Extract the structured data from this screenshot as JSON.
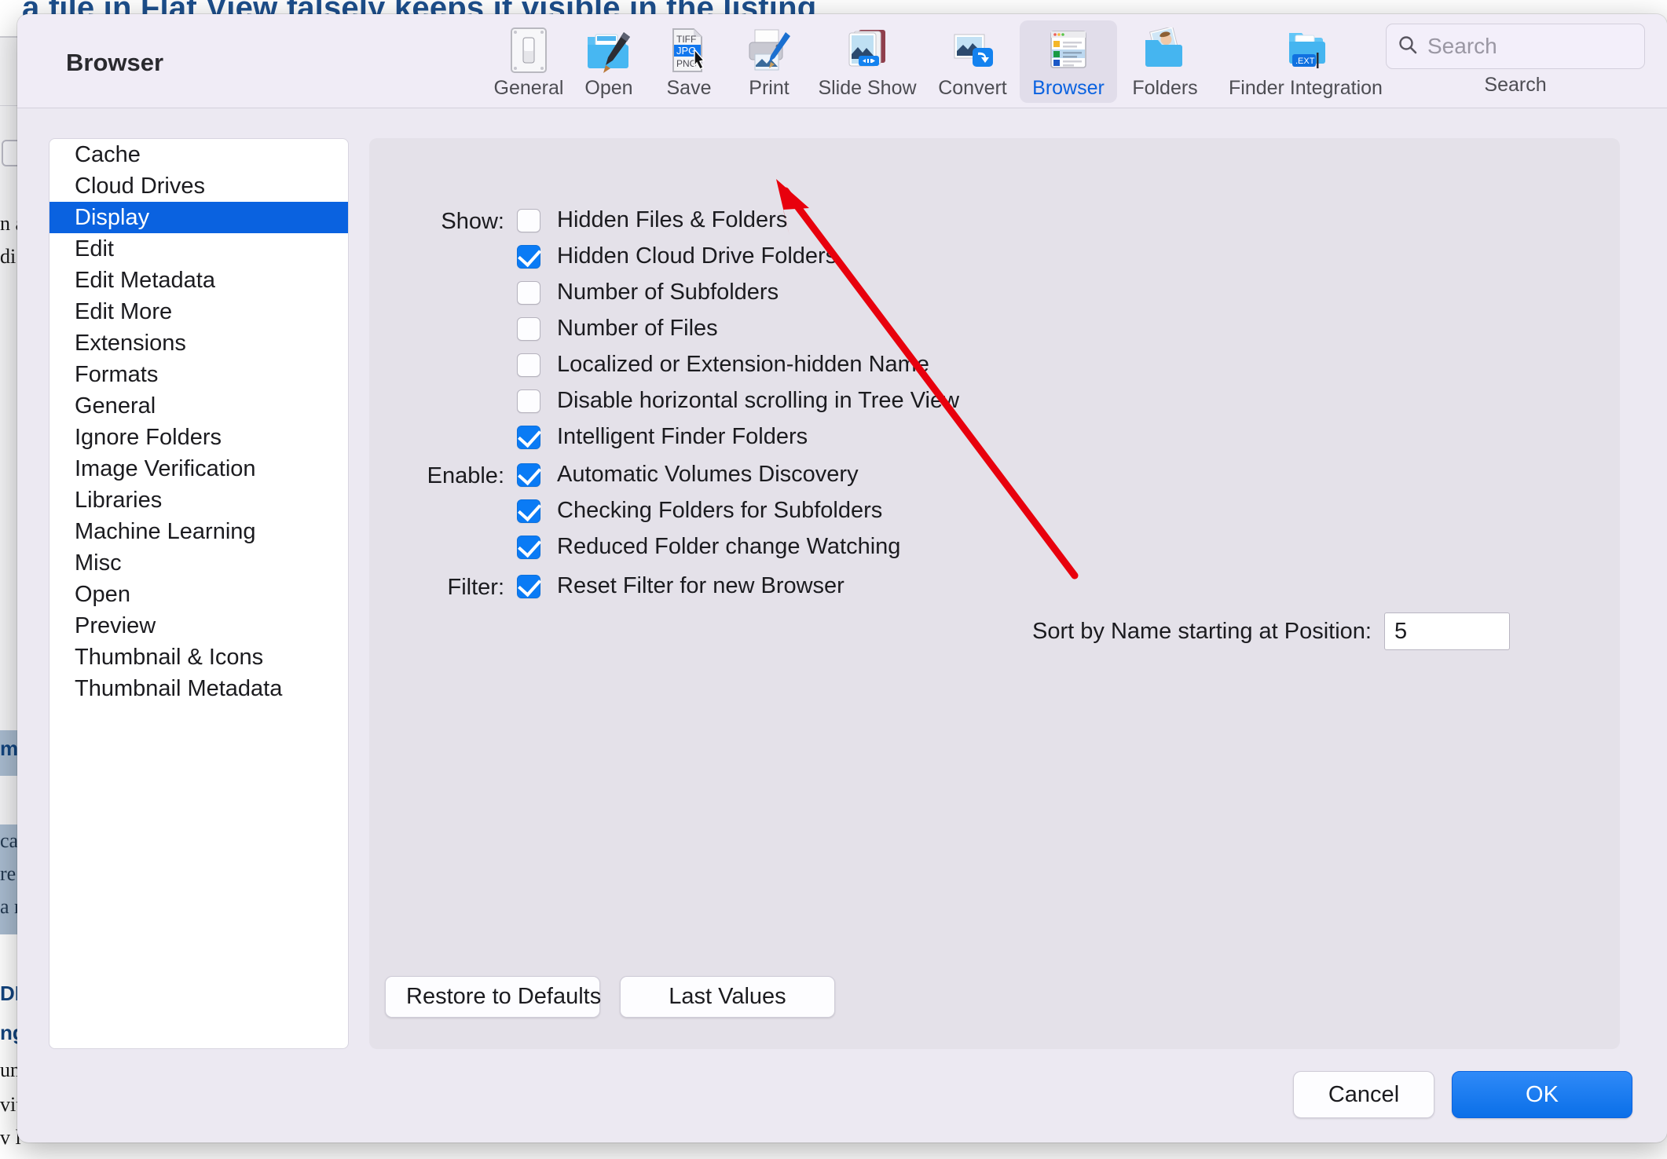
{
  "background": {
    "headline": "a file in Flat View falsely keeps it visible in the listing",
    "snippets": [
      "n a",
      "di",
      "me",
      "cal",
      "re",
      "a n",
      "DE",
      "ng",
      "un",
      "vit",
      "v l"
    ]
  },
  "window": {
    "title": "Browser"
  },
  "toolbar": {
    "items": [
      {
        "label": "General",
        "icon": "switch-icon",
        "selected": false
      },
      {
        "label": "Open",
        "icon": "folder-brush-icon",
        "selected": false
      },
      {
        "label": "Save",
        "icon": "file-formats-icon",
        "selected": false
      },
      {
        "label": "Print",
        "icon": "printer-icon",
        "selected": false
      },
      {
        "label": "Slide Show",
        "icon": "slideshow-icon",
        "selected": false
      },
      {
        "label": "Convert",
        "icon": "convert-icon",
        "selected": false
      },
      {
        "label": "Browser",
        "icon": "browser-window-icon",
        "selected": true
      },
      {
        "label": "Folders",
        "icon": "photo-folder-icon",
        "selected": false
      },
      {
        "label": "Finder Integration",
        "icon": "finder-ext-icon",
        "selected": false
      }
    ],
    "search": {
      "placeholder": "Search",
      "caption": "Search",
      "value": ""
    }
  },
  "sidebar": {
    "items": [
      {
        "label": "Cache",
        "active": false
      },
      {
        "label": "Cloud Drives",
        "active": false
      },
      {
        "label": "Display",
        "active": true
      },
      {
        "label": "Edit",
        "active": false
      },
      {
        "label": "Edit Metadata",
        "active": false
      },
      {
        "label": "Edit More",
        "active": false
      },
      {
        "label": "Extensions",
        "active": false
      },
      {
        "label": "Formats",
        "active": false
      },
      {
        "label": "General",
        "active": false
      },
      {
        "label": "Ignore Folders",
        "active": false
      },
      {
        "label": "Image Verification",
        "active": false
      },
      {
        "label": "Libraries",
        "active": false
      },
      {
        "label": "Machine Learning",
        "active": false
      },
      {
        "label": "Misc",
        "active": false
      },
      {
        "label": "Open",
        "active": false
      },
      {
        "label": "Preview",
        "active": false
      },
      {
        "label": "Thumbnail & Icons",
        "active": false
      },
      {
        "label": "Thumbnail Metadata",
        "active": false
      }
    ]
  },
  "panel": {
    "groups": [
      {
        "label": "Show:",
        "options": [
          {
            "label": "Hidden Files & Folders",
            "checked": false
          },
          {
            "label": "Hidden Cloud Drive Folders",
            "checked": true
          },
          {
            "label": "Number of Subfolders",
            "checked": false
          },
          {
            "label": "Number of Files",
            "checked": false
          },
          {
            "label": "Localized or Extension-hidden Name",
            "checked": false
          },
          {
            "label": "Disable horizontal scrolling in Tree View",
            "checked": false
          },
          {
            "label": "Intelligent Finder Folders",
            "checked": true
          }
        ]
      },
      {
        "label": "Enable:",
        "options": [
          {
            "label": "Automatic Volumes Discovery",
            "checked": true
          },
          {
            "label": "Checking Folders for Subfolders",
            "checked": true
          },
          {
            "label": "Reduced Folder change Watching",
            "checked": true
          }
        ]
      },
      {
        "label": "Filter:",
        "options": [
          {
            "label": "Reset Filter for new Browser",
            "checked": true
          }
        ]
      }
    ],
    "sort_position": {
      "label": "Sort by Name starting at Position:",
      "value": "5"
    },
    "buttons": {
      "restore": "Restore to Defaults",
      "last_values": "Last Values"
    }
  },
  "footer": {
    "cancel": "Cancel",
    "ok": "OK"
  },
  "annotation": {
    "arrow_color": "#e8000d",
    "points_to": "Hidden Files & Folders"
  },
  "colors": {
    "accent": "#0a62e0",
    "checkbox_on": "#0a7bf5",
    "dialog_bg": "#ece9f2",
    "panel_bg": "#e4e1e9",
    "arrow": "#e8000d"
  }
}
